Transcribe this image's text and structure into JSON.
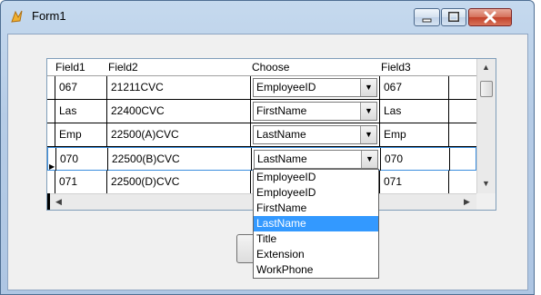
{
  "window": {
    "title": "Form1"
  },
  "grid": {
    "columns": [
      "Field1",
      "Field2",
      "Choose",
      "Field3"
    ],
    "rows": [
      {
        "field1": "067",
        "field2": "21211CVC",
        "choose": "EmployeeID",
        "field3": "067"
      },
      {
        "field1": "Las",
        "field2": "22400CVC",
        "choose": "FirstName",
        "field3": "Las"
      },
      {
        "field1": "Emp",
        "field2": "22500(A)CVC",
        "choose": "LastName",
        "field3": "Emp"
      },
      {
        "field1": "070",
        "field2": "22500(B)CVC",
        "choose": "LastName",
        "field3": "070"
      },
      {
        "field1": "071",
        "field2": "22500(D)CVC",
        "choose": "",
        "field3": "071"
      }
    ],
    "current_row": 4
  },
  "dropdown": {
    "options": [
      "EmployeeID",
      "EmployeeID",
      "FirstName",
      "LastName",
      "Title",
      "Extension",
      "WorkPhone"
    ],
    "selected_index": 3
  },
  "icons": {
    "app": "form-app-icon",
    "minimize": "minimize-icon",
    "maximize": "maximize-icon",
    "close": "close-icon",
    "combo_arrow": "chevron-down-icon"
  },
  "colors": {
    "selection": "#3399ff",
    "current_row_border": "#3a8ede"
  }
}
